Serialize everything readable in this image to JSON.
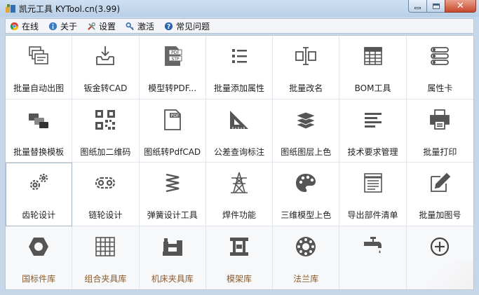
{
  "window": {
    "title": "凯元工具 KYTool.cn(3.99)"
  },
  "menu": [
    {
      "label": "在线",
      "icon": "chrome-icon"
    },
    {
      "label": "关于",
      "icon": "info-icon"
    },
    {
      "label": "设置",
      "icon": "tools-icon"
    },
    {
      "label": "激活",
      "icon": "key-icon"
    },
    {
      "label": "常见问题",
      "icon": "help-icon"
    }
  ],
  "tiles": [
    {
      "label": "批量自动出图",
      "icon": "stacked-drawings-icon"
    },
    {
      "label": "钣金转CAD",
      "icon": "sheetmetal-import-icon"
    },
    {
      "label": "模型转PDF...",
      "icon": "pdf-stp-icon"
    },
    {
      "label": "批量添加属性",
      "icon": "bullet-list-icon"
    },
    {
      "label": "批量改名",
      "icon": "rename-cursor-icon"
    },
    {
      "label": "BOM工具",
      "icon": "bom-table-icon"
    },
    {
      "label": "属性卡",
      "icon": "property-card-icon"
    },
    {
      "label": "批量替换模板",
      "icon": "replace-template-icon"
    },
    {
      "label": "图纸加二维码",
      "icon": "qr-code-icon"
    },
    {
      "label": "图纸转PdfCAD",
      "icon": "pdf-document-icon"
    },
    {
      "label": "公差查询标注",
      "icon": "set-square-icon"
    },
    {
      "label": "图纸图层上色",
      "icon": "layers-icon"
    },
    {
      "label": "技术要求管理",
      "icon": "text-lines-icon"
    },
    {
      "label": "批量打印",
      "icon": "printer-icon"
    },
    {
      "label": "齿轮设计",
      "icon": "gears-icon"
    },
    {
      "label": "链轮设计",
      "icon": "chain-icon"
    },
    {
      "label": "弹簧设计工具",
      "icon": "spring-icon"
    },
    {
      "label": "焊件功能",
      "icon": "tower-icon"
    },
    {
      "label": "三维模型上色",
      "icon": "palette-icon"
    },
    {
      "label": "导出部件清单",
      "icon": "parts-list-icon"
    },
    {
      "label": "批量加图号",
      "icon": "edit-pencil-icon"
    },
    {
      "label": "国标件库",
      "icon": "hex-nut-icon"
    },
    {
      "label": "组合夹具库",
      "icon": "fixture-grid-icon"
    },
    {
      "label": "机床夹具库",
      "icon": "machine-clamp-icon"
    },
    {
      "label": "模架库",
      "icon": "mold-base-icon"
    },
    {
      "label": "法兰库",
      "icon": "flange-icon"
    },
    {
      "label": "",
      "icon": "faucet-icon"
    },
    {
      "label": "",
      "icon": "add-circle-icon"
    }
  ]
}
